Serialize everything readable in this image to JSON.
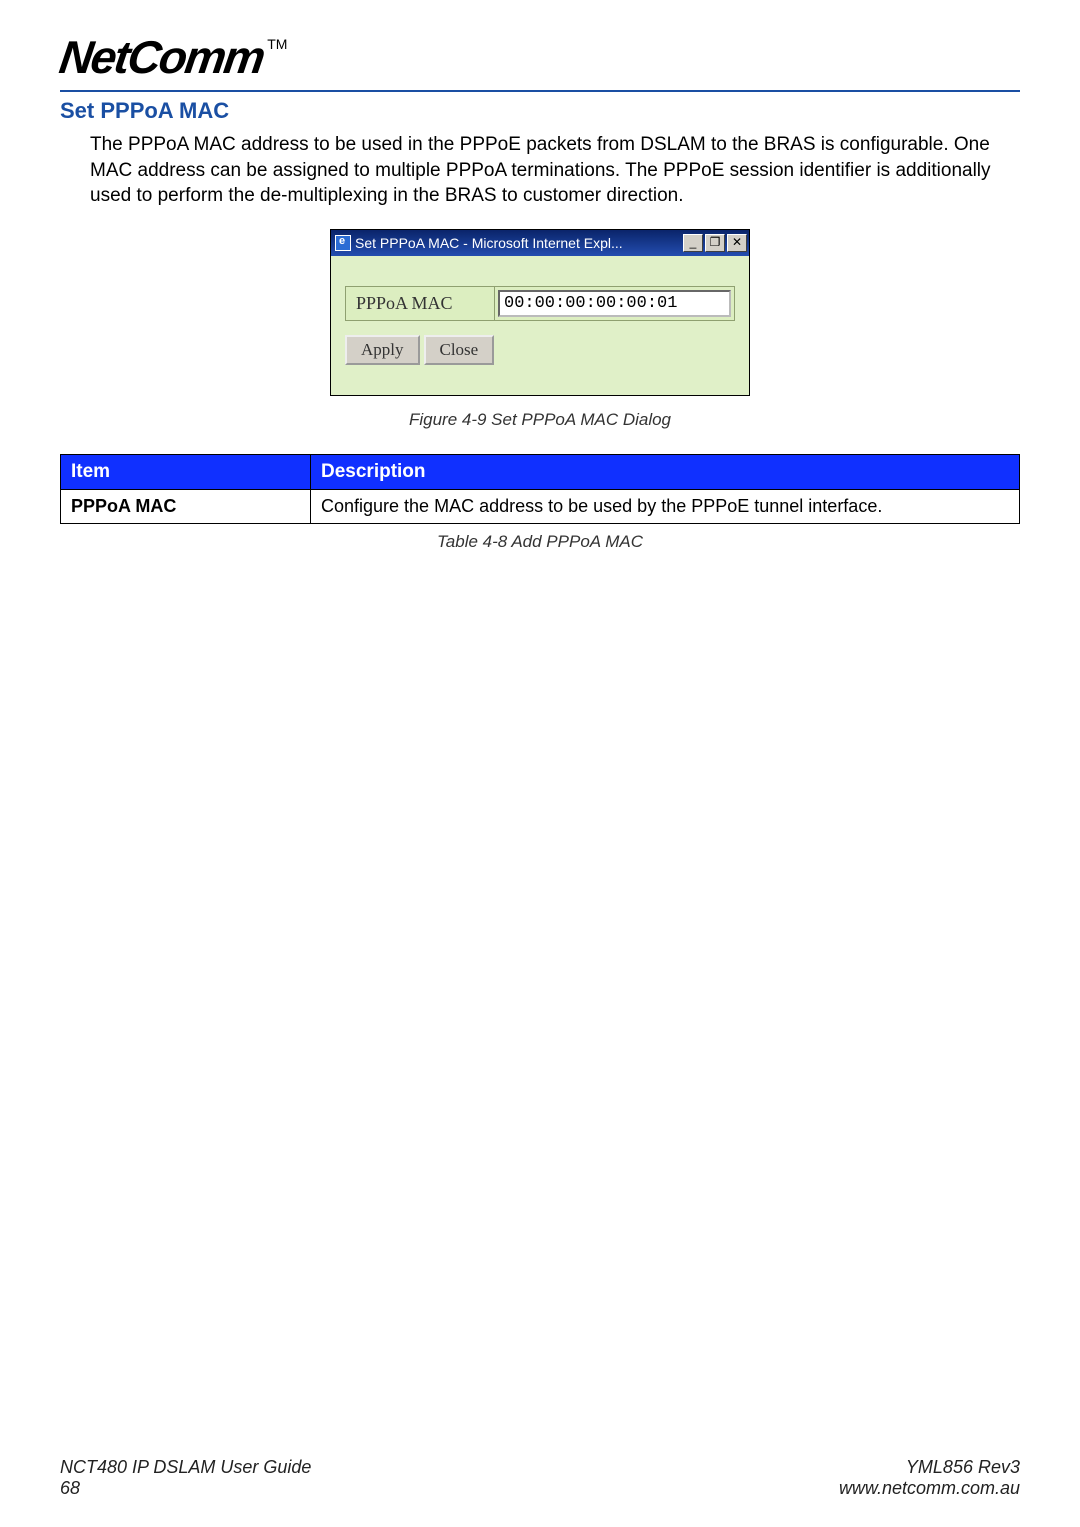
{
  "logo": {
    "text": "NetComm",
    "tm": "TM"
  },
  "heading": "Set PPPoA MAC",
  "body": "The PPPoA MAC address to be used in the PPPoE packets from DSLAM to the BRAS is configurable. One MAC address can be assigned to multiple PPPoA terminations. The PPPoE session identifier is additionally used to perform the de-multiplexing in the BRAS to customer direction.",
  "dialog": {
    "title": "Set PPPoA MAC - Microsoft Internet Expl...",
    "min": "_",
    "restore": "❐",
    "close": "✕",
    "field_label": "PPPoA MAC",
    "field_value": "00:00:00:00:00:01",
    "apply": "Apply",
    "close_btn": "Close"
  },
  "figure_caption": "Figure 4-9 Set PPPoA MAC Dialog",
  "table": {
    "headers": {
      "item": "Item",
      "desc": "Description"
    },
    "rows": [
      {
        "item": "PPPoA MAC",
        "desc": "Configure the MAC address to be used by the PPPoE tunnel interface."
      }
    ]
  },
  "table_caption": "Table 4-8 Add PPPoA MAC",
  "footer": {
    "guide": "NCT480 IP DSLAM User Guide",
    "page": "68",
    "rev": "YML856 Rev3",
    "url": "www.netcomm.com.au"
  }
}
